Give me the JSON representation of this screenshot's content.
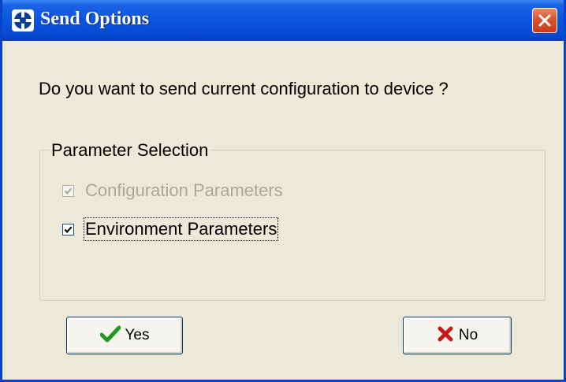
{
  "window": {
    "title": "Send Options"
  },
  "dialog": {
    "question": "Do you want to send current configuration to device ?"
  },
  "parameter_selection": {
    "legend": "Parameter Selection",
    "options": [
      {
        "label": "Configuration Parameters",
        "checked": true,
        "enabled": false
      },
      {
        "label": "Environment Parameters",
        "checked": true,
        "enabled": true
      }
    ]
  },
  "buttons": {
    "yes_label": "Yes",
    "no_label": "No"
  },
  "colors": {
    "titlebar": "#0a55df",
    "close": "#d9532f",
    "check_green": "#1f9a1f",
    "cross_red": "#cc1a1a",
    "face": "#ece9d8"
  },
  "icons": {
    "app": "compass-icon",
    "close": "close-icon",
    "yes": "check-icon",
    "no": "x-icon"
  }
}
